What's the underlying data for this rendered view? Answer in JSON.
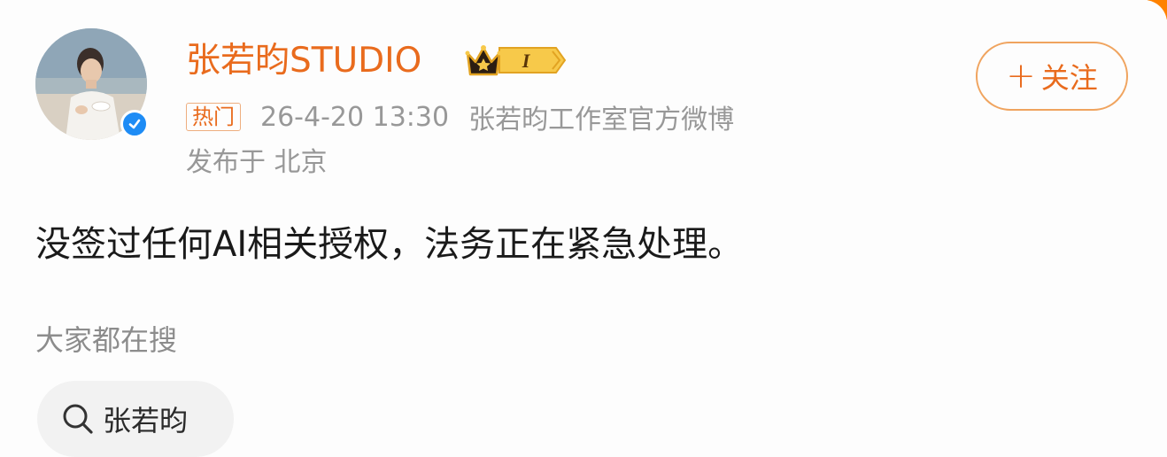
{
  "post": {
    "username": "张若昀STUDIO",
    "crown_level": "I",
    "hot_badge": "热门",
    "time": "26-4-20 13:30",
    "source": "张若昀工作室官方微博",
    "location": "发布于 北京",
    "text": "没签过任何AI相关授权，法务正在紧急处理。"
  },
  "follow_button": {
    "plus": "+",
    "label": "关注"
  },
  "search_section": {
    "heading": "大家都在搜",
    "chips": [
      {
        "label": "张若昀",
        "icon": "search-icon"
      }
    ]
  },
  "colors": {
    "accent": "#e96b1d",
    "verified": "#1e8cf5",
    "muted_text": "#989898"
  },
  "icons": {
    "verified": "verified-check-icon",
    "crown": "crown-level-icon",
    "search": "search-icon"
  }
}
